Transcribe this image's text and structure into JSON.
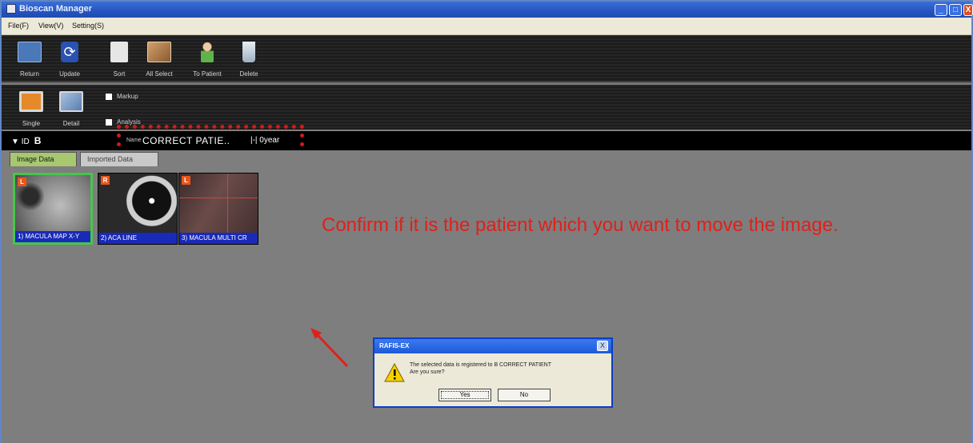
{
  "window": {
    "title": "Bioscan Manager",
    "controls": {
      "minimize": "_",
      "maximize": "□",
      "close": "X"
    }
  },
  "menu": [
    "File(F)",
    "View(V)",
    "Setting(S)"
  ],
  "toolbar": {
    "row1": [
      {
        "label": "Return",
        "icon": "return-icon",
        "color": "#4a78b8"
      },
      {
        "label": "Update",
        "icon": "update-icon",
        "color": "#e0e6f5"
      },
      {
        "label": "Sort",
        "icon": "sort-icon",
        "color": "#f0f0f0"
      },
      {
        "label": "All Select",
        "icon": "all-select-icon",
        "color": "#c79a64"
      },
      {
        "label": "To Patient",
        "icon": "to-patient-icon",
        "color": "#5fb34a"
      },
      {
        "label": "Delete",
        "icon": "delete-icon",
        "color": "#cfd8e2"
      }
    ],
    "row2": [
      {
        "label": "Single",
        "icon": "single-view-icon",
        "color": "#e58a2a"
      },
      {
        "label": "Detail",
        "icon": "detail-view-icon",
        "color": "#7a9cc8"
      }
    ],
    "checkboxes": [
      {
        "label": "Markup",
        "checked": false
      },
      {
        "label": "Analysis",
        "checked": false
      }
    ]
  },
  "patient": {
    "id_label": "ID",
    "id_value": "B",
    "name_label": "Name",
    "name_value": "CORRECT PATIE..",
    "age": "|-|  0year"
  },
  "tabs": [
    {
      "label": "Image Data",
      "active": true
    },
    {
      "label": "Imported Data",
      "active": false
    }
  ],
  "thumbnails": [
    {
      "eye": "L",
      "caption": "1) MACULA MAP X-Y",
      "selected": true
    },
    {
      "eye": "R",
      "caption": "2) ACA LINE",
      "selected": false
    },
    {
      "eye": "L",
      "caption": "3) MACULA MULTI CR",
      "selected": false
    }
  ],
  "annotation": "Confirm if it is the patient which you want to move the image.",
  "dialog": {
    "title": "RAFIS-EX",
    "message_line1": "The selected data is registered to B CORRECT PATIENT",
    "message_line2": "Are you sure?",
    "yes": "Yes",
    "no": "No",
    "close": "X"
  },
  "colors": {
    "annotation": "#e0201a",
    "highlight_border": "#d11a1a",
    "selected_thumb": "#44c74a",
    "caption_bg": "#1a2ab8"
  }
}
